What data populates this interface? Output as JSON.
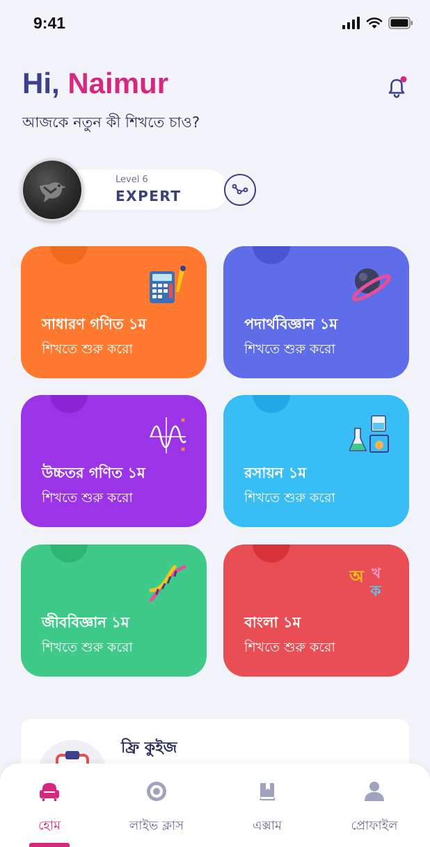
{
  "status_bar": {
    "time": "9:41"
  },
  "header": {
    "greeting_prefix": "Hi,",
    "user_name": "Naimur",
    "subtitle": "আজকে নতুন কী শিখতে চাও?"
  },
  "level": {
    "level_text": "Level 6",
    "rank": "EXPERT"
  },
  "cards": [
    {
      "title": "সাধারণ গণিত ১ম",
      "action": "শিখতে শুরু করো",
      "color": "#ff7a2f",
      "notch": "#f06a1e",
      "icon": "calculator-icon"
    },
    {
      "title": "পদার্থবিজ্ঞান ১ম",
      "action": "শিখতে শুরু করো",
      "color": "#5f6de8",
      "notch": "#4a55d6",
      "icon": "planet-icon"
    },
    {
      "title": "উচ্চতর গণিত ১ম",
      "action": "শিখতে শুরু করো",
      "color": "#9b34e6",
      "notch": "#8a25d2",
      "icon": "graph-icon"
    },
    {
      "title": "রসায়ন ১ম",
      "action": "শিখতে শুরু করো",
      "color": "#38bdf5",
      "notch": "#22a8e6",
      "icon": "chemistry-icon"
    },
    {
      "title": "জীববিজ্ঞান ১ম",
      "action": "শিখতে শুরু করো",
      "color": "#3fca89",
      "notch": "#2db574",
      "icon": "dna-icon"
    },
    {
      "title": "বাংলা ১ম",
      "action": "শিখতে শুরু করো",
      "color": "#e84e54",
      "notch": "#d63238",
      "icon": "bangla-letters-icon"
    }
  ],
  "quiz": {
    "title": "ফ্রি কুইজ"
  },
  "nav": {
    "items": [
      {
        "label": "হোম",
        "icon": "home-icon",
        "active": true
      },
      {
        "label": "লাইভ ক্লাস",
        "icon": "live-icon",
        "active": false
      },
      {
        "label": "এক্সাম",
        "icon": "exam-book-icon",
        "active": false
      },
      {
        "label": "প্রোফাইল",
        "icon": "profile-icon",
        "active": false
      }
    ]
  },
  "colors": {
    "accent": "#d6287f",
    "primary": "#3b3f8c",
    "background": "#f3f4f9"
  }
}
